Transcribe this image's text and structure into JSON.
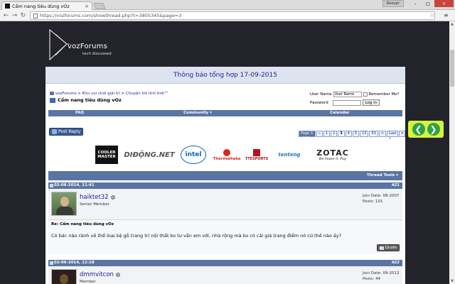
{
  "browser": {
    "tab_title": "Cẩm nang tiêu dùng vOz",
    "tab_close": "×",
    "user_badge": "Reisqir",
    "min": "–",
    "max": "□",
    "close": "×",
    "back": "←",
    "forward": "→",
    "reload": "↻",
    "url": "https://vozforums.com/showthread.php?t=3805345&page=3",
    "star": "☆",
    "menu": "≡"
  },
  "site": {
    "logo_text": "vozForums",
    "logo_sub": "tech discussed",
    "announcement": "Thông báo tổng hợp 17-09-2015"
  },
  "breadcrumb": {
    "items": [
      "vozForums",
      "Khu vui chơi giải trí",
      "Chuyện trò linh tinh™"
    ],
    "separator": " > ",
    "current": "Cẩm nang tiêu dùng vOz"
  },
  "login": {
    "username_label": "User Name",
    "username_value": "User Name",
    "password_label": "Password",
    "remember_label": "Remember Me?",
    "login_button": "Log in"
  },
  "navbar": {
    "faq": "FAQ",
    "community": "Community ▾",
    "calendar": "Calendar"
  },
  "post_reply": "Post Reply",
  "pager": {
    "label": "Page 3 of 54",
    "pages": [
      "«",
      "1",
      "2",
      "3",
      "4",
      "5",
      "13",
      "53",
      ">",
      "Last »"
    ],
    "current": "3",
    "menu": "▾"
  },
  "sponsors": [
    "COOLER MASTER",
    "DIĐỘNG.NET",
    "intel",
    "Thermaltake",
    "TTESPORTS",
    "tenteng",
    "ZOTAC"
  ],
  "sponsor_sub": {
    "zotac": "We Power It, Play",
    "thermaltake": "Tt eSPORTS"
  },
  "thread_tools": "Thread Tools ▾",
  "posts": [
    {
      "date": "02-06-2014, 11:41",
      "number": "#21",
      "username": "haiktet32",
      "user_title": "Senior Member",
      "join_date": "Join Date: 08-2007",
      "post_count": "Posts: 101",
      "title": "Re: Cẩm nang tiêu dùng vOz",
      "text": "Có bác nào rành về thể loại kệ gỗ trang trí nội thất ko tư vấn em với, nhà rộng mà ko có cái giá trang điểm nó cứ thế nào ấy?",
      "quote_label": "Quote"
    },
    {
      "date": "02-06-2014, 12:18",
      "number": "#22",
      "username": "dmmvitcon",
      "user_title": "Member",
      "join_date": "Join Date: 09-2012",
      "post_count": "Posts: 44"
    }
  ],
  "colors": {
    "page_bg": "#23232b",
    "nav_blue": "#5a74a3",
    "link": "#22229c",
    "widget_bg": "#d7f23c",
    "widget_circle": "#2fa24a"
  },
  "arrow_widget": {
    "left": "❮",
    "right": "❯"
  }
}
